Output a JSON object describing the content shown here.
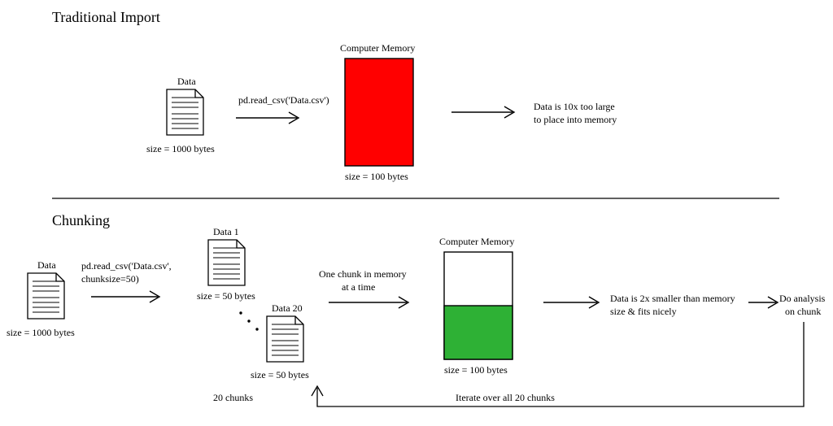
{
  "top": {
    "title": "Traditional Import",
    "data": {
      "label": "Data",
      "size": "size = 1000 bytes"
    },
    "code": "pd.read_csv('Data.csv')",
    "memory": {
      "label": "Computer Memory",
      "size": "size = 100 bytes",
      "fill": "#ff0000"
    },
    "result": {
      "l1": "Data is 10x too large",
      "l2": "to place into memory"
    }
  },
  "bottom": {
    "title": "Chunking",
    "data": {
      "label": "Data",
      "size": "size = 1000 bytes"
    },
    "code": {
      "l1": "pd.read_csv('Data.csv',",
      "l2": "chunksize=50)"
    },
    "chunk1": {
      "label": "Data 1",
      "size": "size = 50 bytes"
    },
    "chunk20": {
      "label": "Data 20",
      "size": "size = 50 bytes"
    },
    "chunks_count": "20 chunks",
    "chunk_note": {
      "l1": "One chunk in memory",
      "l2": "at a time"
    },
    "memory": {
      "label": "Computer Memory",
      "size": "size = 100 bytes",
      "fill": "#2eb135"
    },
    "result": {
      "l1": "Data is 2x smaller than memory",
      "l2": "size & fits nicely"
    },
    "analysis": {
      "l1": "Do analysis",
      "l2": "on chunk"
    },
    "iterate": "Iterate over all 20 chunks"
  }
}
